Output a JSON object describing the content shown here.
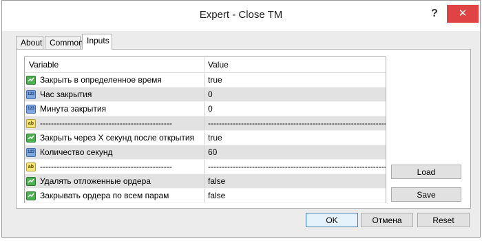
{
  "window": {
    "title": "Expert - Close TM",
    "help_glyph": "?",
    "close_glyph": "✕"
  },
  "tabs": [
    {
      "label": "About"
    },
    {
      "label": "Common"
    },
    {
      "label": "Inputs"
    }
  ],
  "grid": {
    "columns": {
      "variable": "Variable",
      "value": "Value"
    },
    "rows": [
      {
        "type": "bool",
        "icon": "bool-icon",
        "variable": "Закрыть в определенное время",
        "value": "true"
      },
      {
        "type": "int",
        "icon": "int-icon",
        "variable": "Час закрытия",
        "value": "0"
      },
      {
        "type": "int",
        "icon": "int-icon",
        "variable": "Минута закрытия",
        "value": "0"
      },
      {
        "type": "string",
        "icon": "string-icon",
        "variable": "------------------------------------------------",
        "value": "------------------------------------------------------------------------------..."
      },
      {
        "type": "bool",
        "icon": "bool-icon",
        "variable": "Закрыть через X секунд после открытия",
        "value": "true"
      },
      {
        "type": "int",
        "icon": "int-icon",
        "variable": "Количество секунд",
        "value": "60"
      },
      {
        "type": "string",
        "icon": "string-icon",
        "variable": "------------------------------------------------",
        "value": "------------------------------------------------------------------------------..."
      },
      {
        "type": "bool",
        "icon": "bool-icon",
        "variable": "Удалять отложенные ордера",
        "value": "false"
      },
      {
        "type": "bool",
        "icon": "bool-icon",
        "variable": "Закрывать ордера по всем парам",
        "value": "false"
      }
    ],
    "icon_text": {
      "int": "123",
      "string": "ab"
    }
  },
  "buttons": {
    "load": "Load",
    "save": "Save",
    "ok": "OK",
    "cancel": "Отмена",
    "reset": "Reset"
  },
  "colors": {
    "accent": "#3c7fb1",
    "close": "#e04343",
    "selected_row": "#e2e2e2"
  }
}
